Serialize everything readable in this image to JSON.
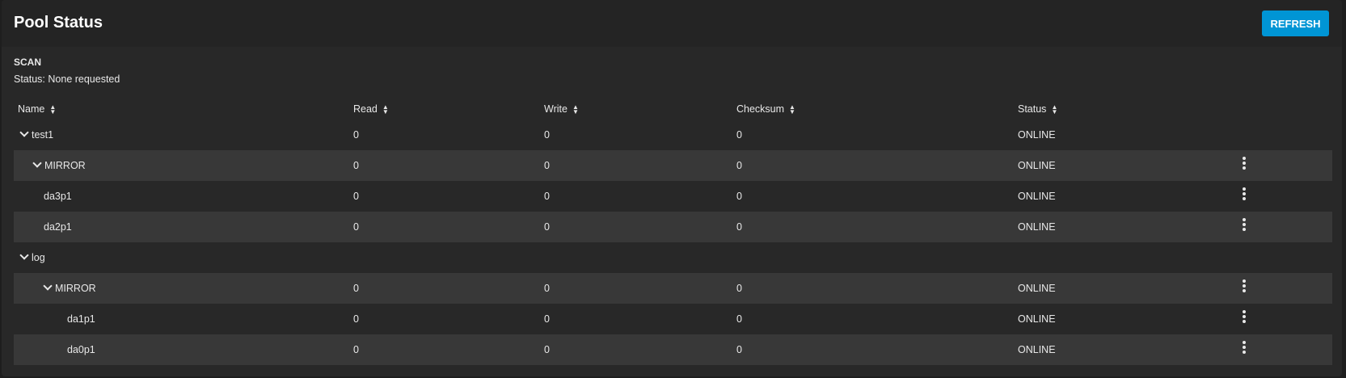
{
  "header": {
    "title": "Pool Status",
    "refresh_label": "REFRESH"
  },
  "scan": {
    "label": "SCAN",
    "status": "Status: None requested"
  },
  "columns": [
    "Name",
    "Read",
    "Write",
    "Checksum",
    "Status"
  ],
  "rows": [
    {
      "name": "test1",
      "read": "0",
      "write": "0",
      "checksum": "0",
      "status": "ONLINE"
    },
    {
      "name": "MIRROR",
      "read": "0",
      "write": "0",
      "checksum": "0",
      "status": "ONLINE"
    },
    {
      "name": "da3p1",
      "read": "0",
      "write": "0",
      "checksum": "0",
      "status": "ONLINE"
    },
    {
      "name": "da2p1",
      "read": "0",
      "write": "0",
      "checksum": "0",
      "status": "ONLINE"
    },
    {
      "name": "log"
    },
    {
      "name": "MIRROR",
      "read": "0",
      "write": "0",
      "checksum": "0",
      "status": "ONLINE"
    },
    {
      "name": "da1p1",
      "read": "0",
      "write": "0",
      "checksum": "0",
      "status": "ONLINE"
    },
    {
      "name": "da0p1",
      "read": "0",
      "write": "0",
      "checksum": "0",
      "status": "ONLINE"
    }
  ],
  "colors": {
    "accent": "#0095d5",
    "stripe": "#383838"
  }
}
